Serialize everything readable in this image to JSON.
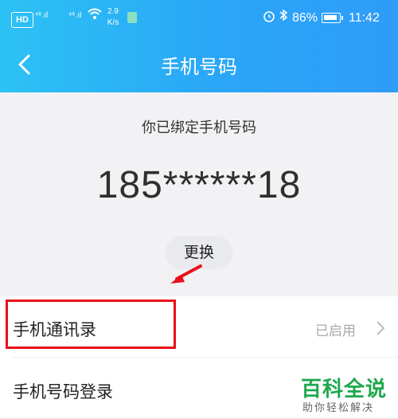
{
  "status_bar": {
    "hd": "HD",
    "signal1": "⁴⁶.ıl",
    "signal2": "⁴⁶.ıl",
    "speed": "2.9\nK/s",
    "battery_pct": "86%",
    "time": "11:42"
  },
  "header": {
    "title": "手机号码"
  },
  "main": {
    "bound_label": "你已绑定手机号码",
    "phone": "185******18",
    "change_label": "更换"
  },
  "list": {
    "items": [
      {
        "label": "手机通讯录",
        "value": "已启用"
      },
      {
        "label": "手机号码登录"
      }
    ]
  },
  "watermark": {
    "title": "百科全说",
    "subtitle": "助你轻松解决"
  },
  "colors": {
    "header_start": "#2cc2f4",
    "header_end": "#2f9cf8",
    "highlight": "#e8101a",
    "watermark": "#1ea84c"
  }
}
